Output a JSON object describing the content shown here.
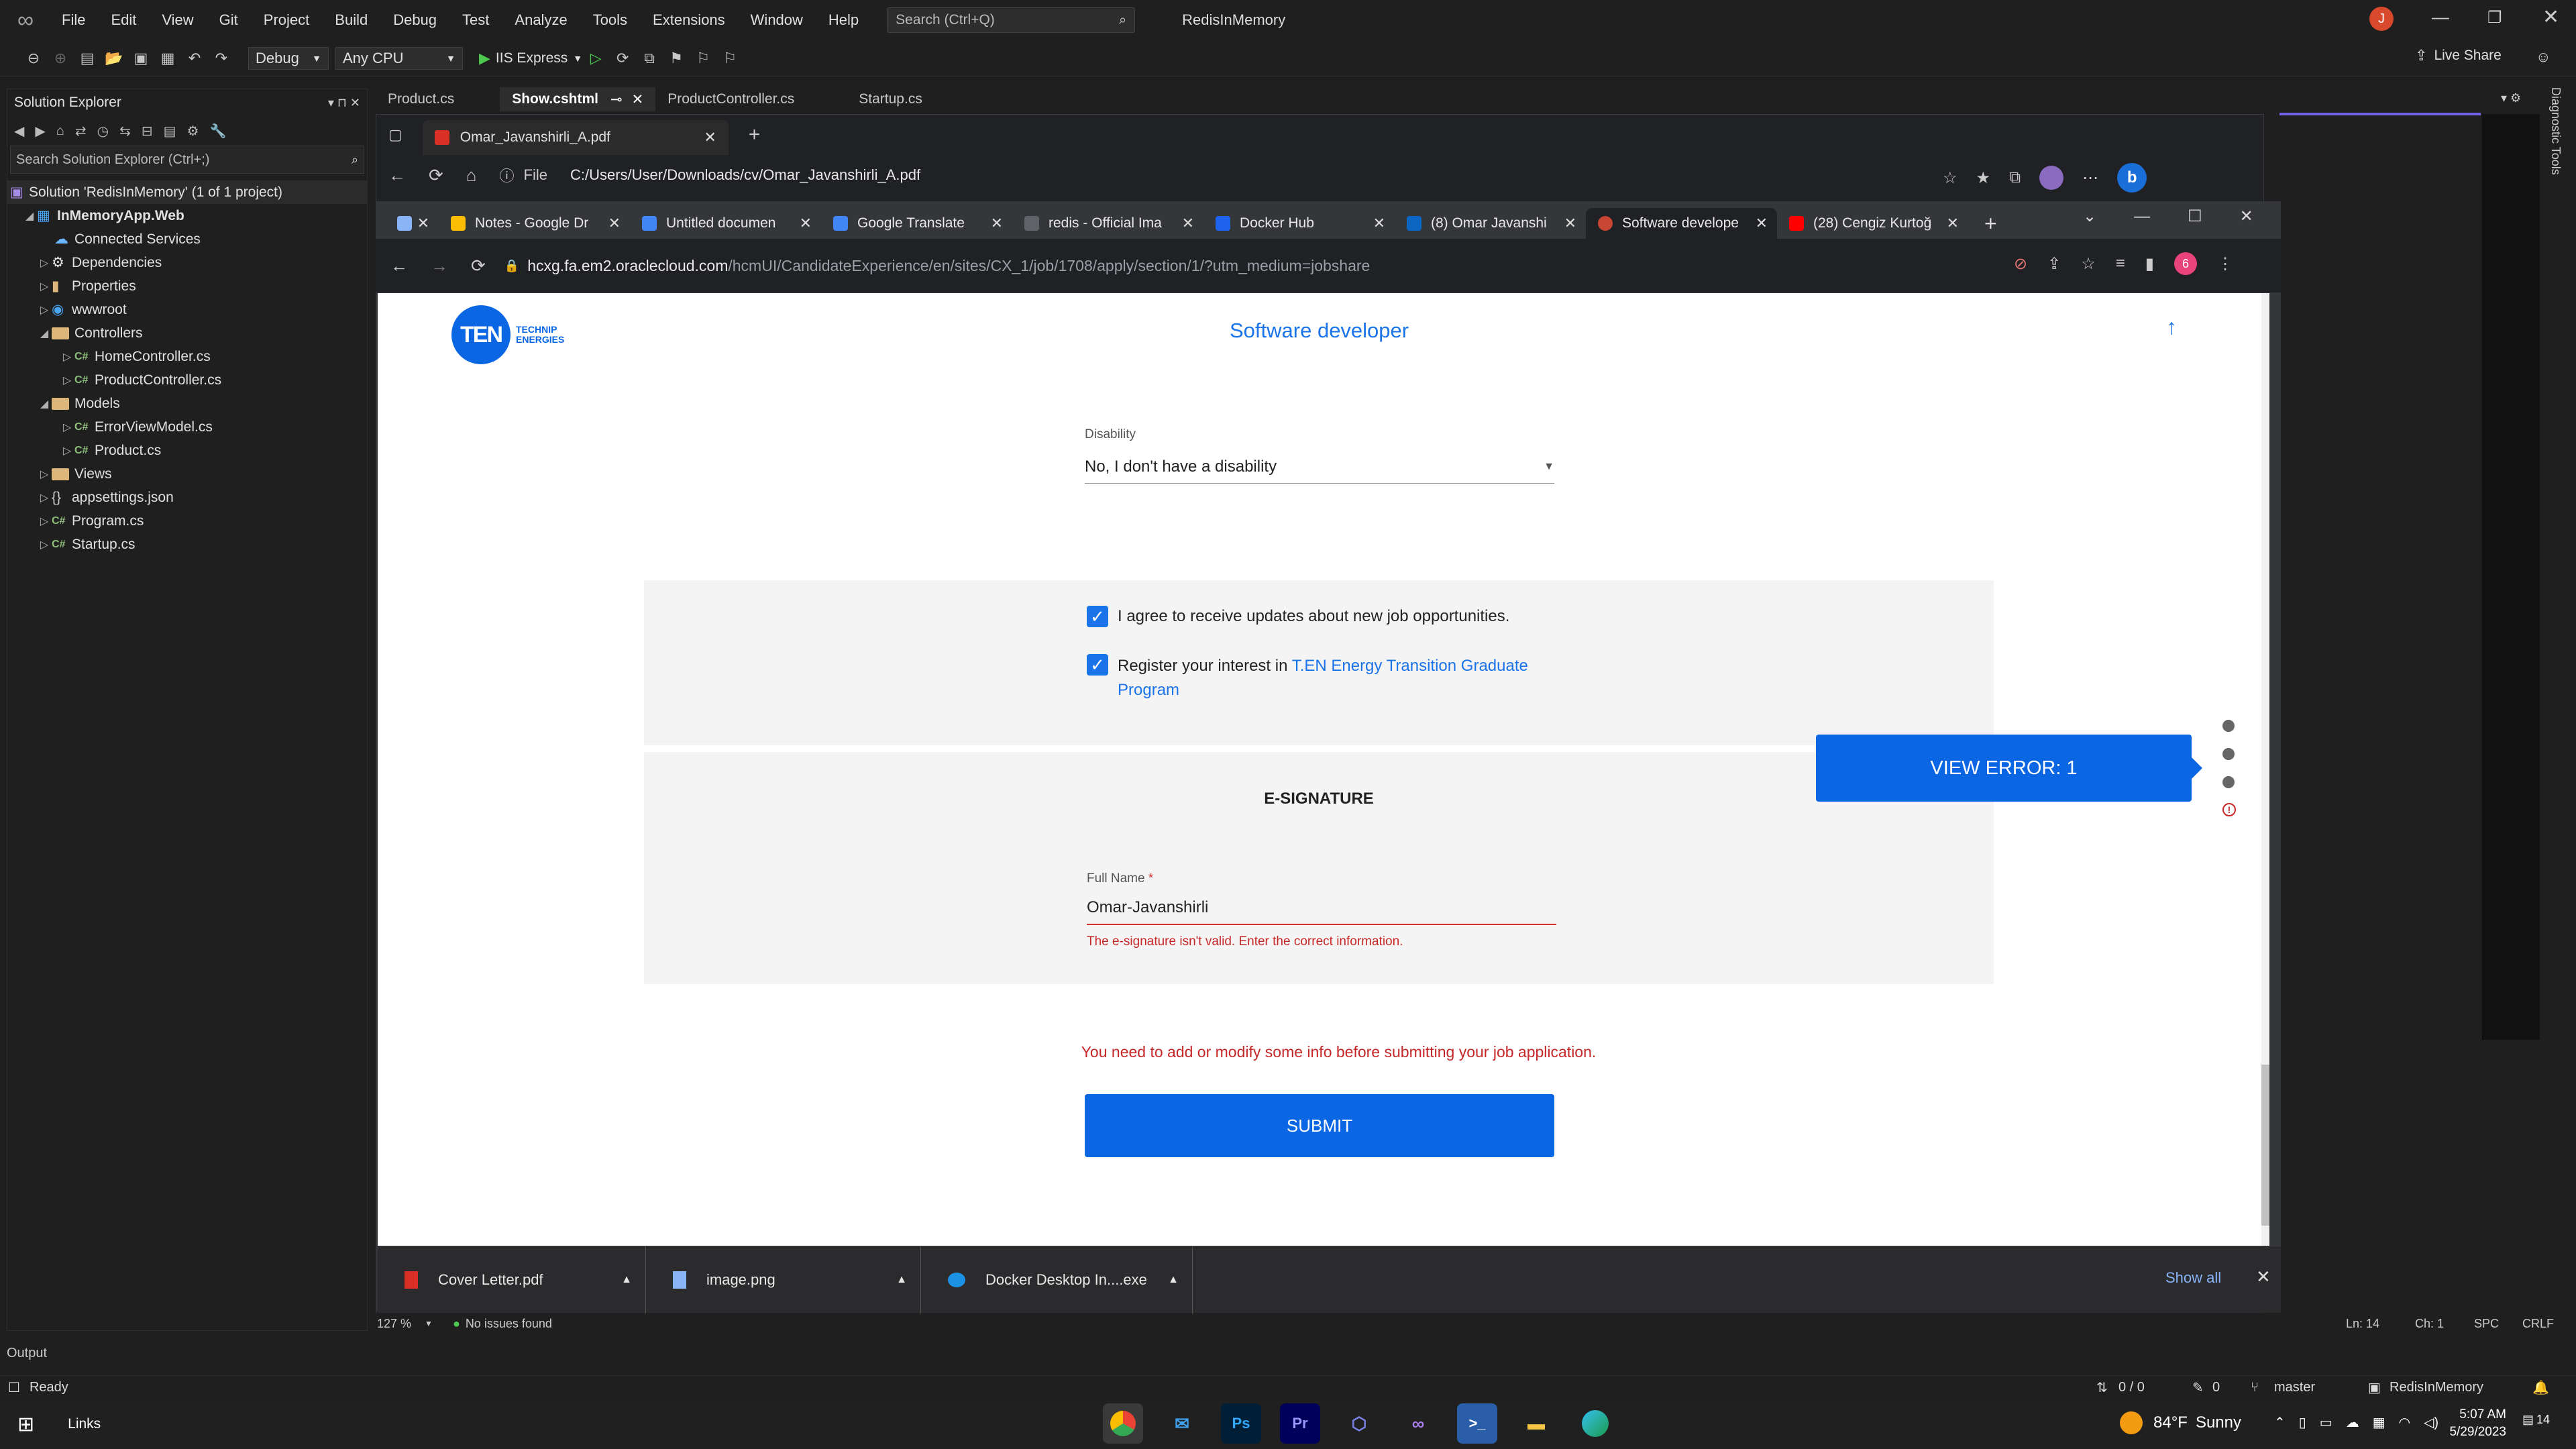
{
  "vs": {
    "menu": [
      "File",
      "Edit",
      "View",
      "Git",
      "Project",
      "Build",
      "Debug",
      "Test",
      "Analyze",
      "Tools",
      "Extensions",
      "Window",
      "Help"
    ],
    "search_placeholder": "Search (Ctrl+Q)",
    "solution_name": "RedisInMemory",
    "user_initial": "J",
    "config": "Debug",
    "platform": "Any CPU",
    "run_target": "IIS Express",
    "live_share": "Live Share",
    "doc_tabs": [
      "Product.cs",
      "Show.cshtml",
      "ProductController.cs",
      "Startup.cs"
    ],
    "solution_explorer": {
      "title": "Solution Explorer",
      "search_placeholder": "Search Solution Explorer (Ctrl+;)",
      "items": [
        {
          "label": "Solution 'RedisInMemory' (1 of 1 project)",
          "depth": 0
        },
        {
          "label": "InMemoryApp.Web",
          "depth": 1
        },
        {
          "label": "Connected Services",
          "depth": 2
        },
        {
          "label": "Dependencies",
          "depth": 2
        },
        {
          "label": "Properties",
          "depth": 2
        },
        {
          "label": "wwwroot",
          "depth": 2
        },
        {
          "label": "Controllers",
          "depth": 2
        },
        {
          "label": "HomeController.cs",
          "depth": 3
        },
        {
          "label": "ProductController.cs",
          "depth": 3
        },
        {
          "label": "Models",
          "depth": 2
        },
        {
          "label": "ErrorViewModel.cs",
          "depth": 3
        },
        {
          "label": "Product.cs",
          "depth": 3
        },
        {
          "label": "Views",
          "depth": 2
        },
        {
          "label": "appsettings.json",
          "depth": 2
        },
        {
          "label": "Program.cs",
          "depth": 2
        },
        {
          "label": "Startup.cs",
          "depth": 2
        }
      ]
    },
    "output_label": "Output",
    "status_ready": "Ready",
    "status_lines": "0 / 0",
    "status_pencil": "0",
    "branch": "master",
    "repo": "RedisInMemory",
    "zoom": "127 %",
    "issues": "No issues found",
    "ln": "Ln: 14",
    "ch": "Ch: 1",
    "spc": "SPC",
    "crlf": "CRLF",
    "diagnostic_tools": "Diagnostic Tools"
  },
  "edge": {
    "tab_title": "Omar_Javanshirli_A.pdf",
    "address_label": "File",
    "address": "C:/Users/User/Downloads/cv/Omar_Javanshirli_A.pdf"
  },
  "chrome": {
    "tabs": [
      {
        "title": "",
        "color": "#8ab4f8"
      },
      {
        "title": "Notes - Google Dr",
        "color": "#fbbc04"
      },
      {
        "title": "Untitled documen",
        "color": "#4285f4"
      },
      {
        "title": "Google Translate",
        "color": "#4285f4"
      },
      {
        "title": "redis - Official Ima",
        "color": "#5f6368"
      },
      {
        "title": "Docker Hub",
        "color": "#1d63ed"
      },
      {
        "title": "(8) Omar Javanshi",
        "color": "#0a66c2"
      },
      {
        "title": "Software develope",
        "color": "#c74634"
      },
      {
        "title": "(28) Cengiz Kurtoğ",
        "color": "#ff0000"
      }
    ],
    "url_host": "hcxg.fa.em2.oraclecloud.com",
    "url_path": "/hcmUI/CandidateExperience/en/sites/CX_1/job/1708/apply/section/1/?utm_medium=jobshare",
    "profile_badge": "6"
  },
  "page": {
    "logo_text": "TEN",
    "logo_sub1": "TECHNIP",
    "logo_sub2": "ENERGIES",
    "job_title": "Software developer",
    "disability_label": "Disability",
    "disability_value": "No, I don't have a disability",
    "agree_updates": "I agree to receive updates about new job opportunities.",
    "register_prefix": "Register your interest in ",
    "register_link": "T.EN Energy Transition Graduate Program",
    "esig_heading": "E-SIGNATURE",
    "fullname_label": "Full Name",
    "required_mark": "*",
    "fullname_value": "Omar-Javanshirli",
    "fullname_error": "The e-signature isn't valid. Enter the correct information.",
    "form_error": "You need to add or modify some info before submitting your job application.",
    "submit": "SUBMIT",
    "view_error": "VIEW ERROR: 1"
  },
  "downloads": {
    "items": [
      "Cover Letter.pdf",
      "image.png",
      "Docker Desktop In....exe"
    ],
    "show_all": "Show all"
  },
  "taskbar": {
    "links": "Links",
    "weather_temp": "84°F",
    "weather_desc": "Sunny",
    "time": "5:07 AM",
    "date": "5/29/2023",
    "notif_count": "14"
  }
}
